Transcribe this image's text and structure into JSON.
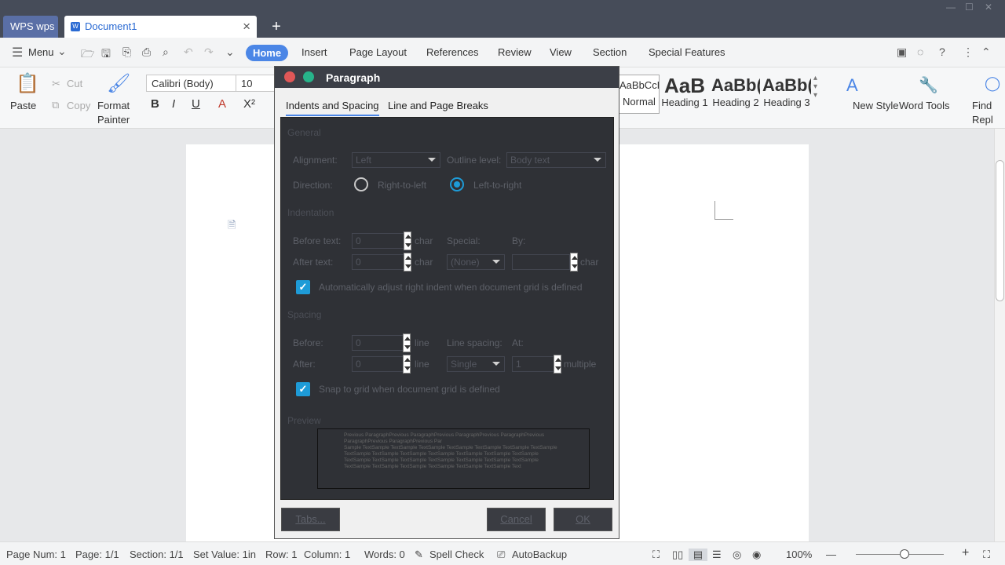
{
  "titlebar": {
    "app_tab": "WPS wps",
    "doc_tab": "Document1",
    "new_tab_glyph": "+"
  },
  "menubar": {
    "menu_label": "Menu",
    "tabs": [
      "Home",
      "Insert",
      "Page Layout",
      "References",
      "Review",
      "View",
      "Section",
      "Special Features"
    ]
  },
  "ribbon": {
    "paste": "Paste",
    "cut": "Cut",
    "copy": "Copy",
    "format_painter_1": "Format",
    "format_painter_2": "Painter",
    "font_name": "Calibri (Body)",
    "font_size": "10",
    "styles": [
      {
        "preview": "AaBbCcDc",
        "label": "Normal"
      },
      {
        "preview": "AaB",
        "label": "Heading 1"
      },
      {
        "preview": "AaBb(",
        "label": "Heading 2"
      },
      {
        "preview": "AaBb(",
        "label": "Heading 3"
      }
    ],
    "new_style": "New Style",
    "word_tools": "Word Tools",
    "find_1": "Find",
    "find_2": "Repl"
  },
  "dialog": {
    "title": "Paragraph",
    "tabs": [
      "Indents and Spacing",
      "Line and Page Breaks"
    ],
    "general_heading": "General",
    "alignment_label": "Alignment:",
    "alignment_value": "Left",
    "outline_label": "Outline level:",
    "outline_value": "Body text",
    "direction_label": "Direction:",
    "rtl_label": "Right-to-left",
    "ltr_label": "Left-to-right",
    "indentation_heading": "Indentation",
    "before_text_label": "Before text:",
    "before_text_value": "0",
    "after_text_label": "After text:",
    "after_text_value": "0",
    "char_unit": "char",
    "special_label": "Special:",
    "special_value": "(None)",
    "by_label": "By:",
    "auto_adjust_label": "Automatically adjust right indent when document grid is defined",
    "spacing_heading": "Spacing",
    "before_label": "Before:",
    "before_value": "0",
    "after_label": "After:",
    "after_value": "0",
    "line_unit": "line",
    "line_spacing_label": "Line spacing:",
    "line_spacing_value": "Single",
    "at_label": "At:",
    "at_value": "1",
    "multiple_unit": "multiple",
    "snap_label": "Snap to grid when document grid is defined",
    "preview_heading": "Preview",
    "preview_prev": "Previous ParagraphPrevious ParagraphPrevious ParagraphPrevious ParagraphPrevious ParagraphPrevious ParagraphPrevious Par",
    "preview_sample": "Sample TextSample TextSample TextSample TextSample TextSample TextSample TextSample TextSample TextSample TextSample TextSample TextSample TextSample TextSample TextSample TextSample TextSample TextSample TextSample TextSample TextSample TextSample TextSample TextSample TextSample TextSample TextSample Text",
    "tabs_button": "Tabs...",
    "cancel_button": "Cancel",
    "ok_button": "OK"
  },
  "statusbar": {
    "page_num": "Page Num: 1",
    "page": "Page: 1/1",
    "section": "Section: 1/1",
    "set_value": "Set Value: 1in",
    "row": "Row: 1",
    "column": "Column: 1",
    "words": "Words: 0",
    "spell_check": "Spell Check",
    "autobackup": "AutoBackup",
    "zoom": "100%",
    "zoom_level": 0.55
  }
}
